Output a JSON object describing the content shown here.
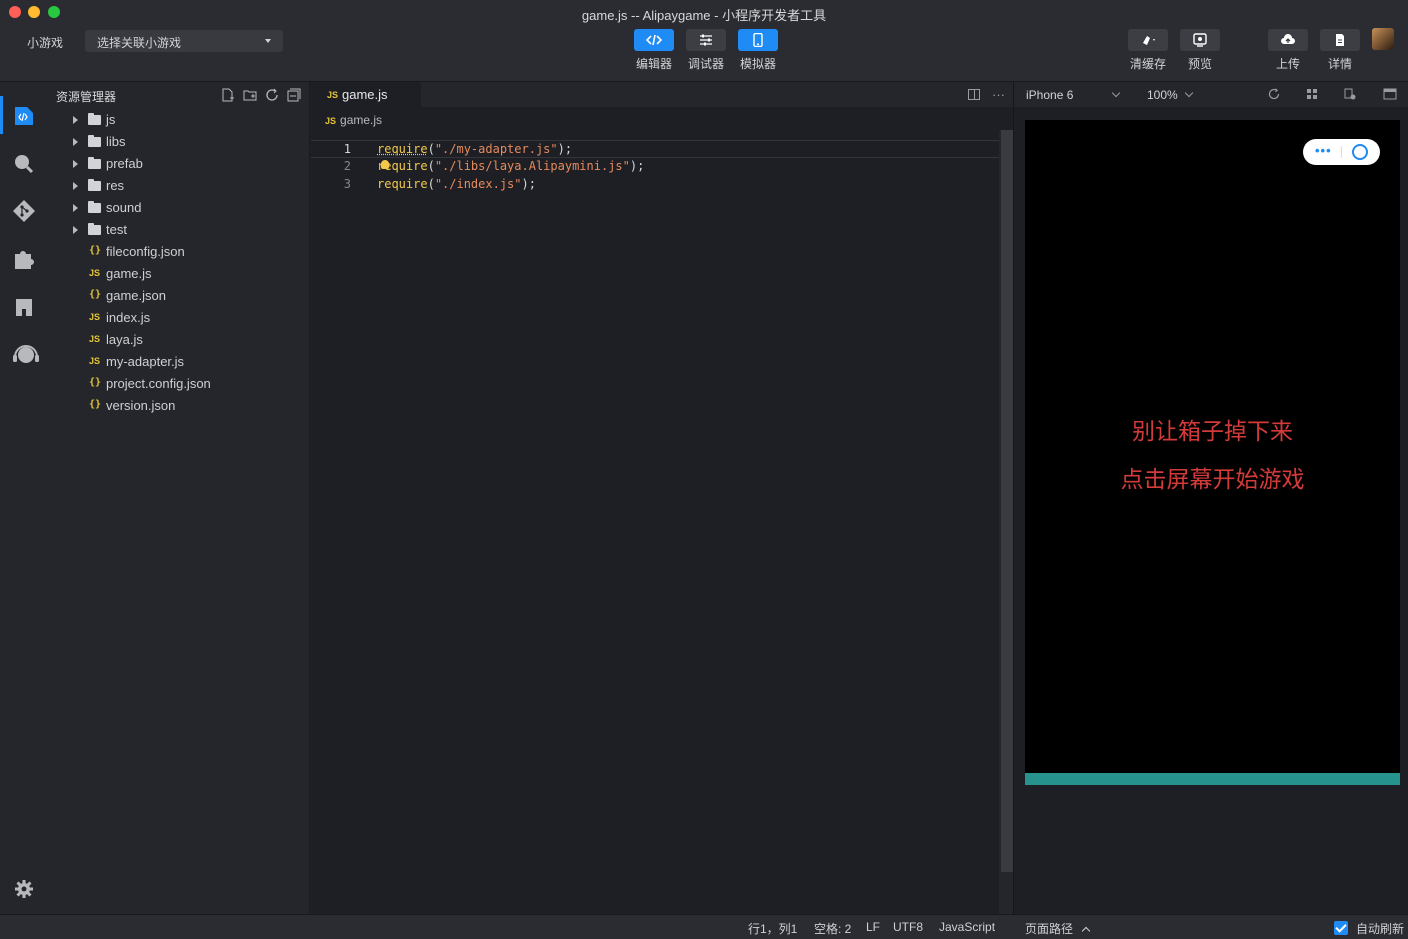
{
  "window": {
    "title": "game.js -- Alipaygame - 小程序开发者工具"
  },
  "toolbar": {
    "mode_label": "小游戏",
    "project_select": "选择关联小游戏",
    "editor_label": "编辑器",
    "debugger_label": "调试器",
    "simulator_label": "模拟器",
    "clear_cache_label": "清缓存",
    "preview_label": "预览",
    "upload_label": "上传",
    "details_label": "详情"
  },
  "explorer": {
    "title": "资源管理器",
    "folders": [
      "js",
      "libs",
      "prefab",
      "res",
      "sound",
      "test"
    ],
    "files": [
      {
        "name": "fileconfig.json",
        "type": "json"
      },
      {
        "name": "game.js",
        "type": "js"
      },
      {
        "name": "game.json",
        "type": "json"
      },
      {
        "name": "index.js",
        "type": "js"
      },
      {
        "name": "laya.js",
        "type": "js"
      },
      {
        "name": "my-adapter.js",
        "type": "js"
      },
      {
        "name": "project.config.json",
        "type": "json"
      },
      {
        "name": "version.json",
        "type": "json"
      }
    ]
  },
  "editor": {
    "tab": "game.js",
    "breadcrumb": "game.js",
    "tab_more": "···",
    "lines": [
      {
        "num": "1",
        "fn": "require",
        "arg": "\"./my-adapter.js\""
      },
      {
        "num": "2",
        "fn": "require",
        "arg": "\"./libs/laya.Alipaymini.js\""
      },
      {
        "num": "3",
        "fn": "require",
        "arg": "\"./index.js\""
      }
    ]
  },
  "simulator": {
    "device": "iPhone 6",
    "zoom": "100%",
    "capsule_dots": "•••",
    "game_line1": "别让箱子掉下来",
    "game_line2": "点击屏幕开始游戏"
  },
  "statusbar": {
    "position": "行1，列1",
    "indent": "空格: 2",
    "eol": "LF",
    "encoding": "UTF8",
    "language": "JavaScript",
    "page_path": "页面路径",
    "auto_refresh": "自动刷新"
  },
  "colors": {
    "accent": "#1f8bf4",
    "game_text": "#d33a3a",
    "progress": "#26938d"
  }
}
